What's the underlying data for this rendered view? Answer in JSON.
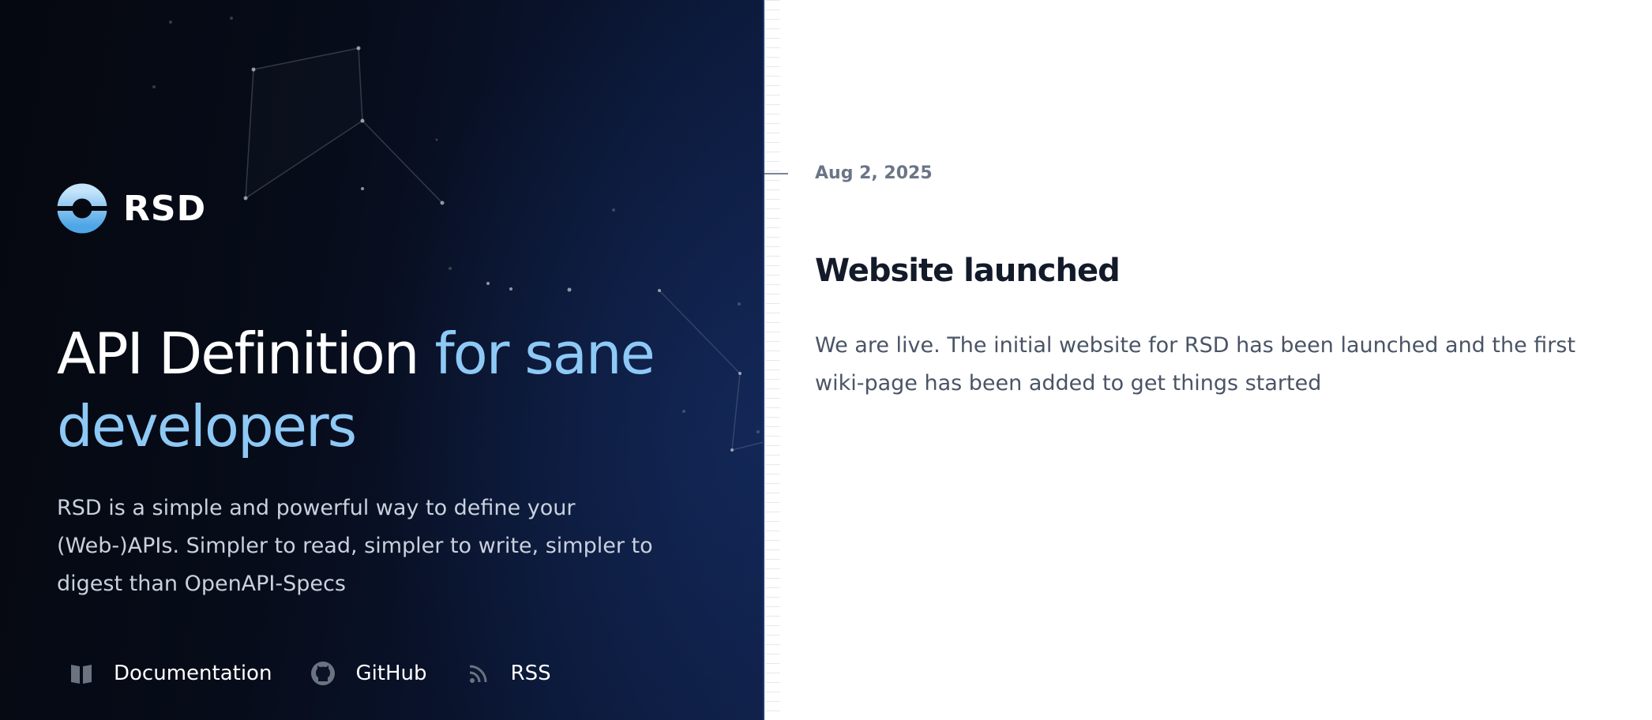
{
  "brand": {
    "name": "RSD",
    "logo_icon": "rsd-ring-logo",
    "accent_color": "#8ec9f6"
  },
  "hero": {
    "headline_main": "API Definition",
    "headline_accent": "for sane developers",
    "description": "RSD is a simple and powerful way to define your (Web-)APIs. Simpler to read, simpler to write, simpler to digest than OpenAPI-Specs",
    "background_color": "#05080f"
  },
  "nav": {
    "items": [
      {
        "label": "Documentation",
        "icon": "book-icon"
      },
      {
        "label": "GitHub",
        "icon": "github-icon"
      },
      {
        "label": "RSS",
        "icon": "rss-icon"
      }
    ]
  },
  "entries": [
    {
      "date": "Aug 2, 2025",
      "title": "Website launched",
      "body": "We are live. The initial website for RSD has been launched and the first wiki-page has been added to get things started"
    }
  ]
}
